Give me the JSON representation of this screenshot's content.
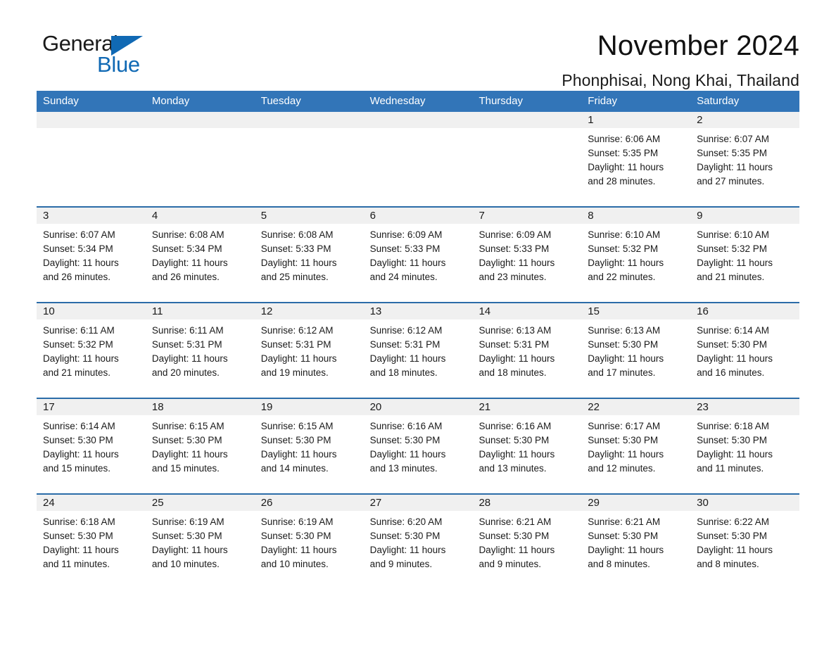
{
  "brand": {
    "name_part1": "General",
    "name_part2": "Blue",
    "triangle_color": "#1069b4"
  },
  "header": {
    "title": "November 2024",
    "location": "Phonphisai, Nong Khai, Thailand"
  },
  "theme": {
    "header_blue": "#3275b8",
    "row_rule_blue": "#2b6ca8",
    "daynum_band": "#f0f0f0",
    "text": "#1a1a1a"
  },
  "calendar": {
    "weekdays": [
      "Sunday",
      "Monday",
      "Tuesday",
      "Wednesday",
      "Thursday",
      "Friday",
      "Saturday"
    ],
    "weeks": [
      [
        {
          "day": "",
          "lines": []
        },
        {
          "day": "",
          "lines": []
        },
        {
          "day": "",
          "lines": []
        },
        {
          "day": "",
          "lines": []
        },
        {
          "day": "",
          "lines": []
        },
        {
          "day": "1",
          "lines": [
            "Sunrise: 6:06 AM",
            "Sunset: 5:35 PM",
            "Daylight: 11 hours",
            "and 28 minutes."
          ]
        },
        {
          "day": "2",
          "lines": [
            "Sunrise: 6:07 AM",
            "Sunset: 5:35 PM",
            "Daylight: 11 hours",
            "and 27 minutes."
          ]
        }
      ],
      [
        {
          "day": "3",
          "lines": [
            "Sunrise: 6:07 AM",
            "Sunset: 5:34 PM",
            "Daylight: 11 hours",
            "and 26 minutes."
          ]
        },
        {
          "day": "4",
          "lines": [
            "Sunrise: 6:08 AM",
            "Sunset: 5:34 PM",
            "Daylight: 11 hours",
            "and 26 minutes."
          ]
        },
        {
          "day": "5",
          "lines": [
            "Sunrise: 6:08 AM",
            "Sunset: 5:33 PM",
            "Daylight: 11 hours",
            "and 25 minutes."
          ]
        },
        {
          "day": "6",
          "lines": [
            "Sunrise: 6:09 AM",
            "Sunset: 5:33 PM",
            "Daylight: 11 hours",
            "and 24 minutes."
          ]
        },
        {
          "day": "7",
          "lines": [
            "Sunrise: 6:09 AM",
            "Sunset: 5:33 PM",
            "Daylight: 11 hours",
            "and 23 minutes."
          ]
        },
        {
          "day": "8",
          "lines": [
            "Sunrise: 6:10 AM",
            "Sunset: 5:32 PM",
            "Daylight: 11 hours",
            "and 22 minutes."
          ]
        },
        {
          "day": "9",
          "lines": [
            "Sunrise: 6:10 AM",
            "Sunset: 5:32 PM",
            "Daylight: 11 hours",
            "and 21 minutes."
          ]
        }
      ],
      [
        {
          "day": "10",
          "lines": [
            "Sunrise: 6:11 AM",
            "Sunset: 5:32 PM",
            "Daylight: 11 hours",
            "and 21 minutes."
          ]
        },
        {
          "day": "11",
          "lines": [
            "Sunrise: 6:11 AM",
            "Sunset: 5:31 PM",
            "Daylight: 11 hours",
            "and 20 minutes."
          ]
        },
        {
          "day": "12",
          "lines": [
            "Sunrise: 6:12 AM",
            "Sunset: 5:31 PM",
            "Daylight: 11 hours",
            "and 19 minutes."
          ]
        },
        {
          "day": "13",
          "lines": [
            "Sunrise: 6:12 AM",
            "Sunset: 5:31 PM",
            "Daylight: 11 hours",
            "and 18 minutes."
          ]
        },
        {
          "day": "14",
          "lines": [
            "Sunrise: 6:13 AM",
            "Sunset: 5:31 PM",
            "Daylight: 11 hours",
            "and 18 minutes."
          ]
        },
        {
          "day": "15",
          "lines": [
            "Sunrise: 6:13 AM",
            "Sunset: 5:30 PM",
            "Daylight: 11 hours",
            "and 17 minutes."
          ]
        },
        {
          "day": "16",
          "lines": [
            "Sunrise: 6:14 AM",
            "Sunset: 5:30 PM",
            "Daylight: 11 hours",
            "and 16 minutes."
          ]
        }
      ],
      [
        {
          "day": "17",
          "lines": [
            "Sunrise: 6:14 AM",
            "Sunset: 5:30 PM",
            "Daylight: 11 hours",
            "and 15 minutes."
          ]
        },
        {
          "day": "18",
          "lines": [
            "Sunrise: 6:15 AM",
            "Sunset: 5:30 PM",
            "Daylight: 11 hours",
            "and 15 minutes."
          ]
        },
        {
          "day": "19",
          "lines": [
            "Sunrise: 6:15 AM",
            "Sunset: 5:30 PM",
            "Daylight: 11 hours",
            "and 14 minutes."
          ]
        },
        {
          "day": "20",
          "lines": [
            "Sunrise: 6:16 AM",
            "Sunset: 5:30 PM",
            "Daylight: 11 hours",
            "and 13 minutes."
          ]
        },
        {
          "day": "21",
          "lines": [
            "Sunrise: 6:16 AM",
            "Sunset: 5:30 PM",
            "Daylight: 11 hours",
            "and 13 minutes."
          ]
        },
        {
          "day": "22",
          "lines": [
            "Sunrise: 6:17 AM",
            "Sunset: 5:30 PM",
            "Daylight: 11 hours",
            "and 12 minutes."
          ]
        },
        {
          "day": "23",
          "lines": [
            "Sunrise: 6:18 AM",
            "Sunset: 5:30 PM",
            "Daylight: 11 hours",
            "and 11 minutes."
          ]
        }
      ],
      [
        {
          "day": "24",
          "lines": [
            "Sunrise: 6:18 AM",
            "Sunset: 5:30 PM",
            "Daylight: 11 hours",
            "and 11 minutes."
          ]
        },
        {
          "day": "25",
          "lines": [
            "Sunrise: 6:19 AM",
            "Sunset: 5:30 PM",
            "Daylight: 11 hours",
            "and 10 minutes."
          ]
        },
        {
          "day": "26",
          "lines": [
            "Sunrise: 6:19 AM",
            "Sunset: 5:30 PM",
            "Daylight: 11 hours",
            "and 10 minutes."
          ]
        },
        {
          "day": "27",
          "lines": [
            "Sunrise: 6:20 AM",
            "Sunset: 5:30 PM",
            "Daylight: 11 hours",
            "and 9 minutes."
          ]
        },
        {
          "day": "28",
          "lines": [
            "Sunrise: 6:21 AM",
            "Sunset: 5:30 PM",
            "Daylight: 11 hours",
            "and 9 minutes."
          ]
        },
        {
          "day": "29",
          "lines": [
            "Sunrise: 6:21 AM",
            "Sunset: 5:30 PM",
            "Daylight: 11 hours",
            "and 8 minutes."
          ]
        },
        {
          "day": "30",
          "lines": [
            "Sunrise: 6:22 AM",
            "Sunset: 5:30 PM",
            "Daylight: 11 hours",
            "and 8 minutes."
          ]
        }
      ]
    ]
  }
}
